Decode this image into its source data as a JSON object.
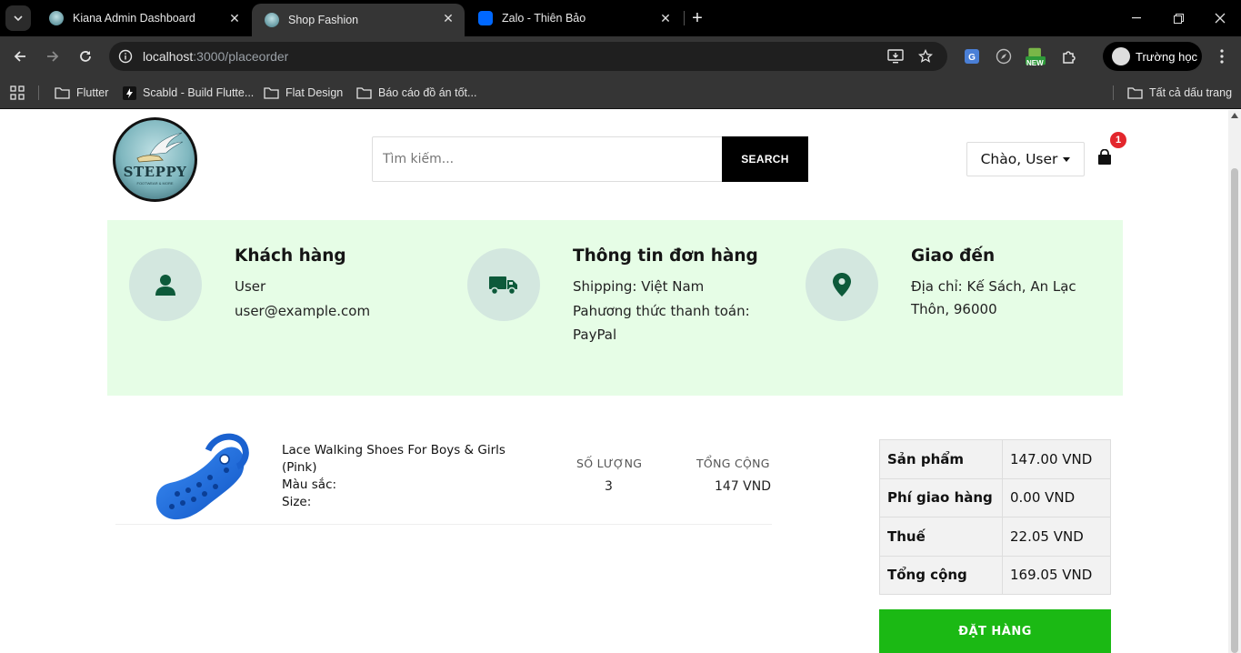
{
  "browser": {
    "tabs": [
      {
        "title": "Kiana Admin Dashboard",
        "active": false
      },
      {
        "title": "Shop Fashion",
        "active": true
      },
      {
        "title": "Zalo - Thiên Bảo",
        "active": false
      }
    ],
    "url_host": "localhost",
    "url_path": ":3000/placeorder",
    "profile_name": "Trường học",
    "ext_badge": "NEW",
    "bookmarks": [
      "Flutter",
      "Scabld - Build Flutte...",
      "Flat Design",
      "Báo cáo đồ án tốt..."
    ],
    "all_bookmarks": "Tất cả dấu trang"
  },
  "header": {
    "logo_text": "STEPPY",
    "logo_subtext": "FOOTWEAR & MORE",
    "search_placeholder": "Tìm kiếm...",
    "search_button": "SEARCH",
    "user_greeting": "Chào, User",
    "cart_count": "1"
  },
  "info": {
    "customer": {
      "title": "Khách hàng",
      "name": "User",
      "email": "user@example.com"
    },
    "order": {
      "title": "Thông tin đơn hàng",
      "shipping": "Shipping: Việt Nam",
      "payment_label": "Pahương thức thanh toán:",
      "payment_value": "PayPal"
    },
    "delivery": {
      "title": "Giao đến",
      "address_line1": "Địa chỉ: Kế Sách, An Lạc",
      "address_line2": "Thôn, 96000"
    }
  },
  "item": {
    "name_line1": "Lace Walking Shoes For Boys & Girls",
    "name_line2": "(Pink)",
    "color_label": "Màu sắc:",
    "size_label": "Size:",
    "qty_header": "SỐ LƯỢNG",
    "qty_value": "3",
    "total_header": "TỔNG CỘNG",
    "total_value": "147 VND"
  },
  "summary": {
    "rows": [
      {
        "label": "Sản phẩm",
        "value": "147.00 VND"
      },
      {
        "label": "Phí giao hàng",
        "value": "0.00 VND"
      },
      {
        "label": "Thuế",
        "value": "22.05 VND"
      },
      {
        "label": "Tổng cộng",
        "value": "169.05 VND"
      }
    ],
    "order_button": "ĐẶT HÀNG"
  },
  "colors": {
    "info_panel_bg": "#e6fde6",
    "icon_circle_bg": "#d3e7df",
    "icon_color": "#0d5a3a",
    "order_button": "#1bb914",
    "cart_badge": "#e3262c"
  }
}
